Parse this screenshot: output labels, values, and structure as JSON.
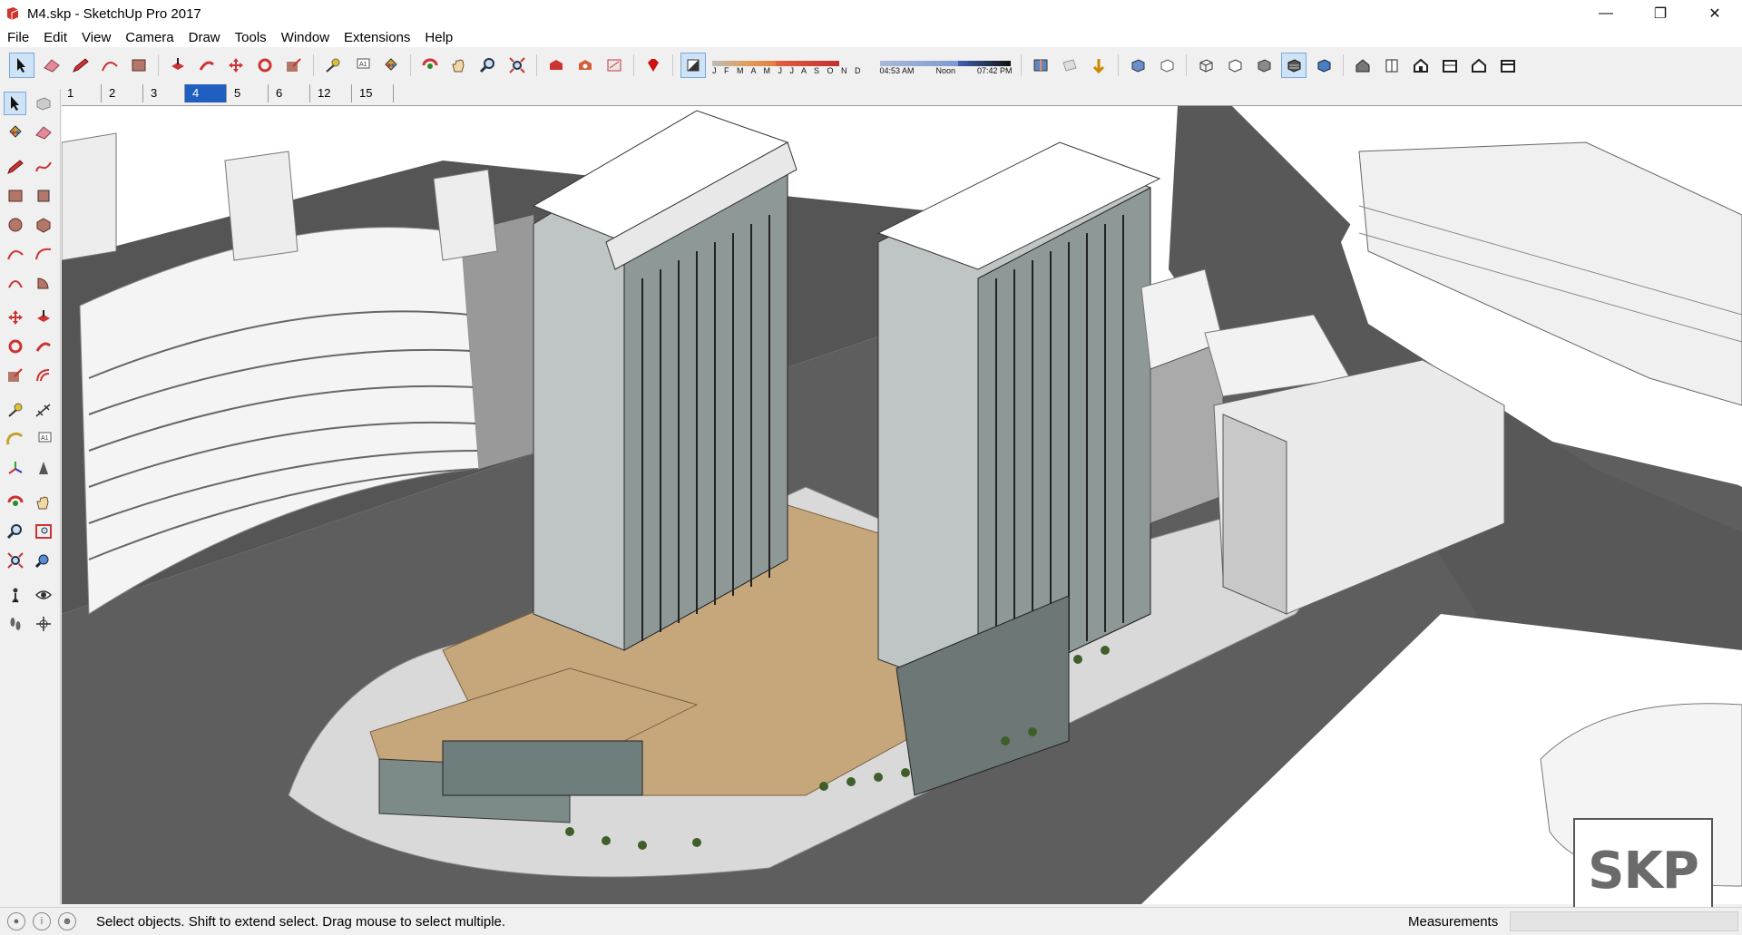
{
  "window": {
    "title": "M4.skp - SketchUp Pro 2017"
  },
  "menu": [
    "File",
    "Edit",
    "View",
    "Camera",
    "Draw",
    "Tools",
    "Window",
    "Extensions",
    "Help"
  ],
  "shadows": {
    "months": "J F M A M J J A S O N D",
    "time_start": "04:53 AM",
    "time_mid": "Noon",
    "time_end": "07:42 PM"
  },
  "scenes": [
    {
      "label": "1",
      "active": false
    },
    {
      "label": "2",
      "active": false
    },
    {
      "label": "3",
      "active": false
    },
    {
      "label": "4",
      "active": true
    },
    {
      "label": "5",
      "active": false
    },
    {
      "label": "6",
      "active": false
    },
    {
      "label": "12",
      "active": false
    },
    {
      "label": "15",
      "active": false
    }
  ],
  "status": {
    "hint": "Select objects. Shift to extend select. Drag mouse to select multiple.",
    "measurements_label": "Measurements",
    "measurements_value": ""
  },
  "logo": {
    "text": "SKP"
  },
  "colors": {
    "accent": "#1e5fbf",
    "paving": "#c6a77c",
    "road": "#5a5a5a"
  }
}
